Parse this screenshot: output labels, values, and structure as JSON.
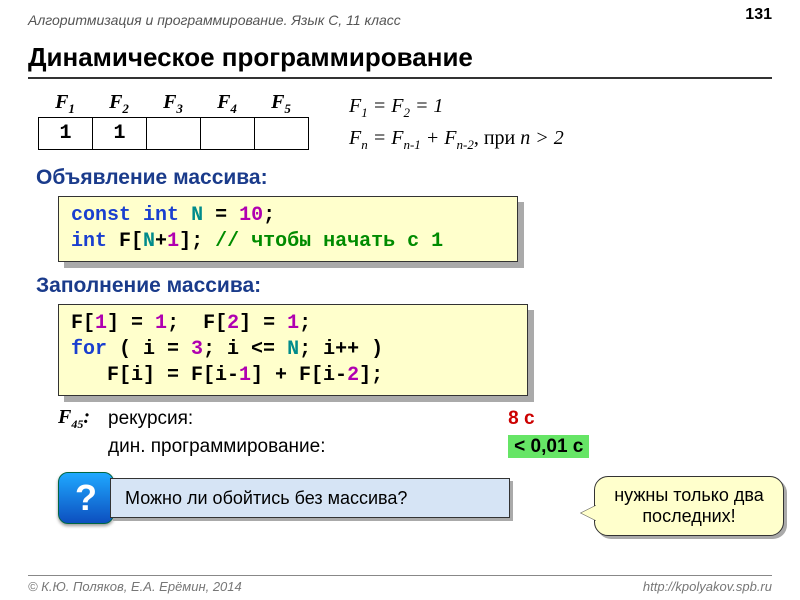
{
  "header": "Алгоритмизация и программирование. Язык C, 11 класс",
  "page_number": "131",
  "title": "Динамическое программирование",
  "table": {
    "headers": [
      "F₁",
      "F₂",
      "F₃",
      "F₄",
      "F₅"
    ],
    "cells": [
      "1",
      "1",
      "",
      "",
      ""
    ]
  },
  "formula": {
    "line1_html": "<i>F</i><sub>1</sub> = <i>F</i><sub>2</sub> = 1",
    "line2_html": "<i>F<sub>n</sub></i> = <i>F</i><sub><i>n</i>-1</sub> + <i>F</i><sub><i>n</i>-2</sub><span class='stext'>, при </span><i>n</i> &gt; 2"
  },
  "section1": "Объявление массива:",
  "code1_lines": [
    {
      "html": "<span class='kw-blue'>const</span> <span class='kw-blue'>int</span> <span class='kw-teal'>N</span> = <span class='kw-mag'>10</span>;"
    },
    {
      "html": "<span class='kw-blue'>int</span> F[<span class='kw-teal'>N</span>+<span class='kw-mag'>1</span>]; <span class='cm'>// чтобы начать с 1</span>"
    }
  ],
  "section2": "Заполнение массива:",
  "code2_lines": [
    {
      "html": "F[<span class='kw-mag'>1</span>] = <span class='kw-mag'>1</span>;  F[<span class='kw-mag'>2</span>] = <span class='kw-mag'>1</span>;"
    },
    {
      "html": "<span class='kw-blue'>for</span> ( i = <span class='kw-mag'>3</span>; i &lt;= <span class='kw-teal'>N</span>; i++ )"
    },
    {
      "html": "   F[i] = F[i-<span class='kw-mag'>1</span>] + F[i-<span class='kw-mag'>2</span>];"
    }
  ],
  "timing": {
    "label_html": "<i>F</i><sub>45</sub>:",
    "row1_label": "рекурсия:",
    "row1_value": "8 с",
    "row2_label": "дин. программирование:",
    "row2_value": "< 0,01 с"
  },
  "question": {
    "mark": "?",
    "text": "Можно ли обойтись без массива?"
  },
  "callout": "нужны только два последних!",
  "footer": {
    "left": "© К.Ю. Поляков, Е.А. Ерёмин, 2014",
    "right": "http://kpolyakov.spb.ru"
  }
}
